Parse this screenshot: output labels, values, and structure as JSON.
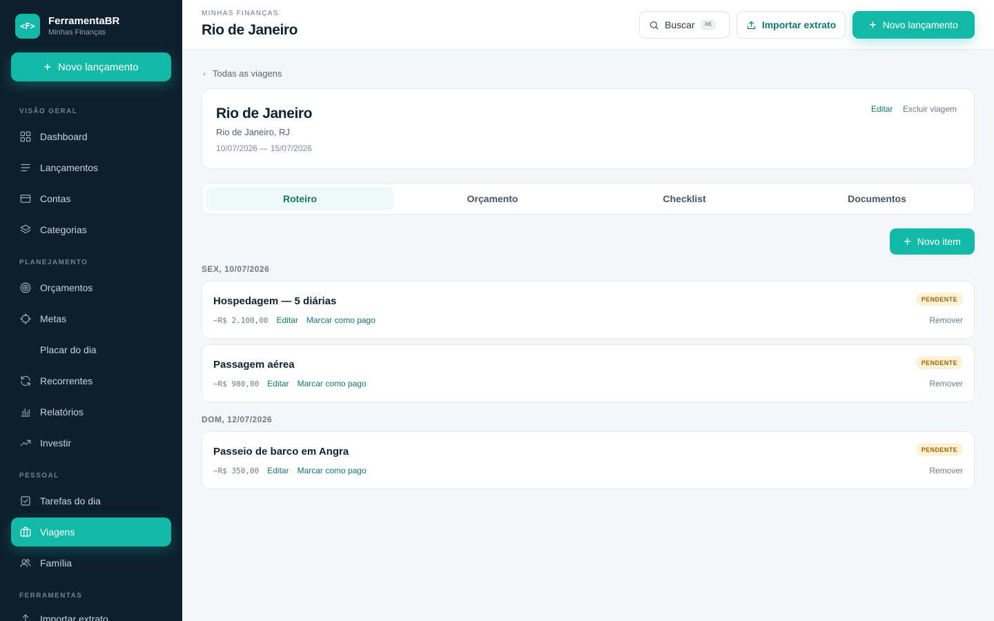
{
  "brand": {
    "logo": "<F>",
    "name": "FerramentaBR",
    "subtitle": "Minhas Finanças"
  },
  "sidebar": {
    "new_button": "Novo lançamento",
    "sections": {
      "overview": "VISÃO GERAL",
      "planning": "PLANEJAMENTO",
      "personal": "PESSOAL",
      "tools": "FERRAMENTAS"
    },
    "items": {
      "dashboard": {
        "label": "Dashboard",
        "icon": "grid-icon"
      },
      "lancamentos": {
        "label": "Lançamentos",
        "icon": "list-icon"
      },
      "contas": {
        "label": "Contas",
        "icon": "wallet-icon"
      },
      "categorias": {
        "label": "Categorias",
        "icon": "layers-icon"
      },
      "orcamentos": {
        "label": "Orçamentos",
        "icon": "target-icon"
      },
      "metas": {
        "label": "Metas",
        "icon": "crosshair-icon"
      },
      "placar": {
        "label": "Placar do dia"
      },
      "recorrentes": {
        "label": "Recorrentes",
        "icon": "refresh-icon"
      },
      "relatorios": {
        "label": "Relatórios",
        "icon": "bar-chart-icon"
      },
      "investir": {
        "label": "Investir",
        "icon": "trend-up-icon"
      },
      "tarefas": {
        "label": "Tarefas do dia",
        "icon": "check-square-icon"
      },
      "viagens": {
        "label": "Viagens",
        "icon": "briefcase-icon",
        "active": true
      },
      "familia": {
        "label": "Família",
        "icon": "users-icon"
      },
      "importar": {
        "label": "Importar extrato",
        "icon": "upload-icon"
      }
    }
  },
  "header": {
    "eyebrow": "MINHAS FINANÇAS",
    "title": "Rio de Janeiro",
    "search_label": "Buscar",
    "search_shortcut": "⌘K",
    "import_label": "Importar extrato",
    "new_label": "Novo lançamento"
  },
  "breadcrumb": {
    "back_label": "Todas as viagens"
  },
  "trip": {
    "title": "Rio de Janeiro",
    "location": "Rio de Janeiro, RJ",
    "dates": "10/07/2026 — 15/07/2026",
    "edit_label": "Editar",
    "delete_label": "Excluir viagem"
  },
  "tabs": [
    "Roteiro",
    "Orçamento",
    "Checklist",
    "Documentos"
  ],
  "active_tab": "Roteiro",
  "new_item_label": "Novo item",
  "days": [
    {
      "label": "SEX, 10/07/2026",
      "items": [
        {
          "title": "Hospedagem — 5 diárias",
          "price": "~R$ 2.100,00",
          "status": "PENDENTE",
          "edit": "Editar",
          "pay": "Marcar como pago",
          "remove": "Remover"
        },
        {
          "title": "Passagem aérea",
          "price": "~R$ 980,00",
          "status": "PENDENTE",
          "edit": "Editar",
          "pay": "Marcar como pago",
          "remove": "Remover"
        }
      ]
    },
    {
      "label": "DOM, 12/07/2026",
      "items": [
        {
          "title": "Passeio de barco em Angra",
          "price": "~R$ 350,00",
          "status": "PENDENTE",
          "edit": "Editar",
          "pay": "Marcar como pago",
          "remove": "Remover"
        }
      ]
    }
  ],
  "colors": {
    "accent": "#14b8a6",
    "accent_dark": "#0f766e",
    "sidebar_bg": "#0d1f2d",
    "badge_bg": "#fdf2d6",
    "badge_text": "#a16207"
  }
}
